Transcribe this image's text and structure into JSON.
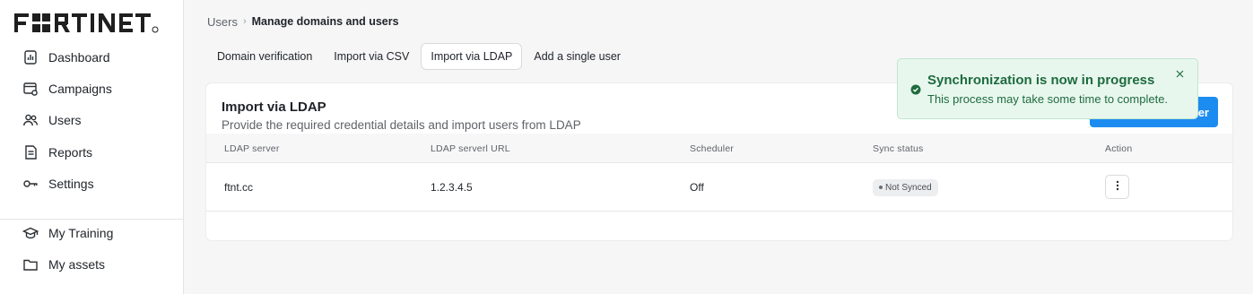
{
  "brand": {
    "logo_text": "FORTINET",
    "accent": "#1d8cf0",
    "logo_color": "#1f1f1f"
  },
  "sidebar": {
    "items": [
      {
        "label": "Dashboard",
        "icon": "dashboard-icon"
      },
      {
        "label": "Campaigns",
        "icon": "campaigns-icon"
      },
      {
        "label": "Users",
        "icon": "users-icon"
      },
      {
        "label": "Reports",
        "icon": "reports-icon"
      },
      {
        "label": "Settings",
        "icon": "key-icon"
      }
    ],
    "bottom_items": [
      {
        "label": "My Training",
        "icon": "graduation-cap-icon"
      },
      {
        "label": "My assets",
        "icon": "folder-icon"
      }
    ]
  },
  "breadcrumb": {
    "parent": "Users",
    "separator": "›",
    "current": "Manage domains and users"
  },
  "tabs": [
    {
      "label": "Domain verification",
      "active": false
    },
    {
      "label": "Import via CSV",
      "active": false
    },
    {
      "label": "Import via LDAP",
      "active": true
    },
    {
      "label": "Add a single user",
      "active": false
    }
  ],
  "card": {
    "title": "Import via LDAP",
    "subtitle": "Provide the required credential details and import users from LDAP",
    "primary_button_visible_text": "er"
  },
  "table": {
    "columns": [
      "LDAP server",
      "LDAP serverl URL",
      "Scheduler",
      "Sync status",
      "Action"
    ],
    "rows": [
      {
        "server": "ftnt.cc",
        "url": "1.2.3.4.5",
        "scheduler": "Off",
        "status": "Not Synced",
        "action_icon": "kebab-menu-icon"
      }
    ]
  },
  "toast": {
    "title": "Synchronization is now in progress",
    "message": "This process may take some time to complete.",
    "icon": "check-circle-icon",
    "close_icon": "close-icon",
    "color": "#1e6b3e",
    "background": "#e8f7ee"
  }
}
